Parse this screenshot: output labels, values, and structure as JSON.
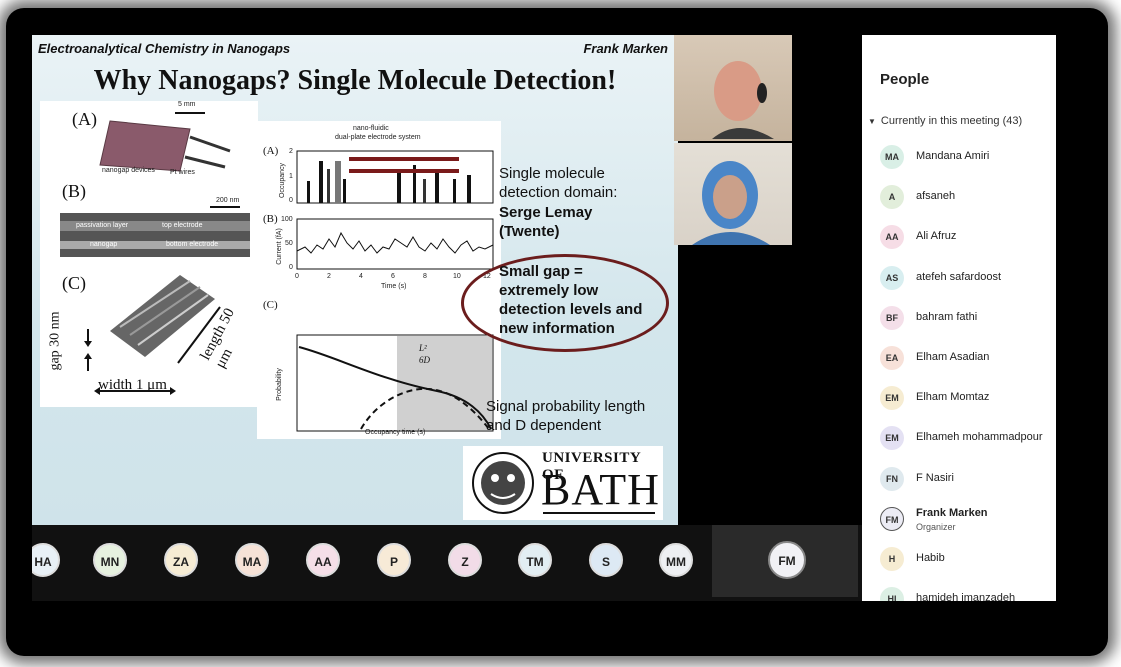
{
  "slide": {
    "course": "Electroanalytical Chemistry in Nanogaps",
    "author": "Frank Marken",
    "title": "Why Nanogaps? Single Molecule Detection!",
    "fig_left": {
      "label_a": "(A)",
      "label_b": "(B)",
      "label_c": "(C)",
      "scale_a": "5 mm",
      "caption_a1": "nanogap devices",
      "caption_a2": "Pt wires",
      "scale_b": "200 nm",
      "b_passivation": "passivation layer",
      "b_top": "top electrode",
      "b_nanogap": "nanogap",
      "b_bottom": "bottom electrode",
      "gap": "gap 30 nm",
      "width": "width 1 μm",
      "length": "length 50 μm"
    },
    "fig_right": {
      "title1": "nano-fluidic",
      "title2": "dual-plate electrode system",
      "label_a": "(A)",
      "label_b": "(B)",
      "label_c": "(C)",
      "ylabel_a": "Occupancy",
      "ylabel_b": "Current (fA)",
      "ylabel_c": "Probability",
      "xlabel_b": "Time (s)",
      "xlabel_c": "Occupancy time (s)",
      "ticks_b": [
        "0",
        "2",
        "4",
        "6",
        "8",
        "10",
        "12"
      ],
      "ticks_ay": [
        "2",
        "1",
        "0"
      ],
      "ticks_by": [
        "100",
        "50",
        "0"
      ],
      "annot": "L²",
      "annot2": "6D"
    },
    "text_domain": [
      "Single molecule",
      "detection domain:"
    ],
    "text_name": [
      "Serge Lemay",
      "(Twente)"
    ],
    "oval_text": [
      "Small gap =",
      "extremely low",
      "detection levels and",
      "new information"
    ],
    "text_signal": [
      "Signal probability length",
      "and D dependent"
    ],
    "logo_university": "UNIVERSITY OF",
    "logo_name": "BATH"
  },
  "people": {
    "title": "People",
    "section": "Currently in this meeting (43)",
    "list": [
      {
        "initials": "MA",
        "name": "Mandana Amiri",
        "color": "#d9efe6"
      },
      {
        "initials": "A",
        "name": "afsaneh",
        "color": "#e2eedb"
      },
      {
        "initials": "AA",
        "name": "Ali Afruz",
        "color": "#f6dde6"
      },
      {
        "initials": "AS",
        "name": "atefeh safardoost",
        "color": "#d8eef0"
      },
      {
        "initials": "BF",
        "name": "bahram fathi",
        "color": "#f4dfe9"
      },
      {
        "initials": "EA",
        "name": "Elham Asadian",
        "color": "#f7e1d9"
      },
      {
        "initials": "EM",
        "name": "Elham Momtaz",
        "color": "#f6ecd2"
      },
      {
        "initials": "EM",
        "name": "Elhameh mohammadpour",
        "color": "#e4e1f3"
      },
      {
        "initials": "FN",
        "name": "F Nasiri",
        "color": "#dfe9ee"
      },
      {
        "initials": "FM",
        "name": "Frank Marken",
        "role": "Organizer",
        "color": "#ececf5"
      },
      {
        "initials": "H",
        "name": "Habib",
        "color": "#f6ecd2"
      },
      {
        "initials": "HI",
        "name": "hamideh imanzadeh",
        "color": "#dcefe4"
      }
    ]
  },
  "bar": {
    "chips": [
      {
        "initials": "HA",
        "color": "#e8f0f6"
      },
      {
        "initials": "MN",
        "color": "#e6f1df"
      },
      {
        "initials": "ZA",
        "color": "#f6ecd4"
      },
      {
        "initials": "MA",
        "color": "#f6e2d7"
      },
      {
        "initials": "AA",
        "color": "#f5dfe8"
      },
      {
        "initials": "P",
        "color": "#f7ead7"
      },
      {
        "initials": "Z",
        "color": "#f2dce8"
      },
      {
        "initials": "TM",
        "color": "#e2eef3"
      },
      {
        "initials": "S",
        "color": "#dde9f4"
      },
      {
        "initials": "MM",
        "color": "#eef0f3"
      }
    ],
    "self": {
      "initials": "FM",
      "color": "#f1f1f5"
    }
  }
}
